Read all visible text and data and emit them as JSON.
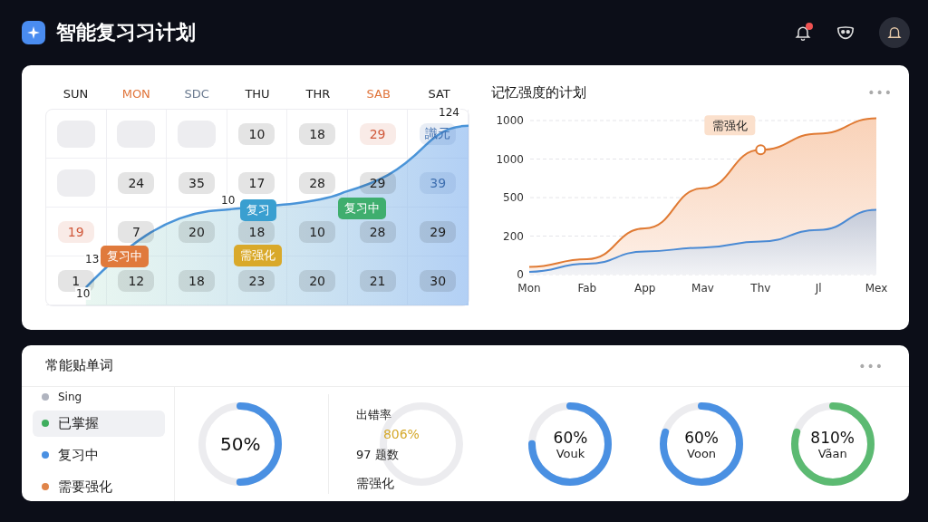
{
  "header": {
    "title": "智能复习习计划",
    "has_notification": true
  },
  "calendar": {
    "weekdays": [
      {
        "label": "SUN",
        "color": "#222222"
      },
      {
        "label": "MON",
        "color": "#e0743a"
      },
      {
        "label": "SDC",
        "color": "#6a7a90"
      },
      {
        "label": "THU",
        "color": "#222222"
      },
      {
        "label": "THR",
        "color": "#222222"
      },
      {
        "label": "SAB",
        "color": "#e0743a"
      },
      {
        "label": "SAT",
        "color": "#222222"
      }
    ],
    "rows": [
      [
        {
          "kind": "blank"
        },
        {
          "kind": "blank"
        },
        {
          "kind": "blank"
        },
        {
          "kind": "day",
          "text": "10",
          "color": "#222222"
        },
        {
          "kind": "day",
          "text": "18",
          "color": "#222222"
        },
        {
          "kind": "day",
          "text": "29",
          "color": "#d0583a"
        },
        {
          "kind": "day",
          "text": "識元",
          "color": "#3e6fb0"
        }
      ],
      [
        {
          "kind": "blank"
        },
        {
          "kind": "day",
          "text": "24",
          "color": "#222222"
        },
        {
          "kind": "day",
          "text": "35",
          "color": "#222222"
        },
        {
          "kind": "day",
          "text": "17",
          "color": "#222222"
        },
        {
          "kind": "day",
          "text": "28",
          "color": "#222222"
        },
        {
          "kind": "day",
          "text": "29",
          "color": "#222222"
        },
        {
          "kind": "day",
          "text": "39",
          "color": "#3e6fb0"
        }
      ],
      [
        {
          "kind": "day",
          "text": "19",
          "color": "#d0583a"
        },
        {
          "kind": "day",
          "text": "7",
          "color": "#222222"
        },
        {
          "kind": "day",
          "text": "20",
          "color": "#222222"
        },
        {
          "kind": "day",
          "text": "18",
          "color": "#222222"
        },
        {
          "kind": "day",
          "text": "10",
          "color": "#222222"
        },
        {
          "kind": "day",
          "text": "28",
          "color": "#222222"
        },
        {
          "kind": "day",
          "text": "29",
          "color": "#222222"
        }
      ],
      [
        {
          "kind": "day",
          "text": "1",
          "color": "#222222"
        },
        {
          "kind": "day",
          "text": "12",
          "color": "#222222"
        },
        {
          "kind": "day",
          "text": "18",
          "color": "#222222"
        },
        {
          "kind": "day",
          "text": "23",
          "color": "#222222"
        },
        {
          "kind": "day",
          "text": "20",
          "color": "#222222"
        },
        {
          "kind": "day",
          "text": "21",
          "color": "#222222"
        },
        {
          "kind": "day",
          "text": "30",
          "color": "#222222"
        }
      ]
    ],
    "curve_labels": [
      "10",
      "13",
      "10",
      "124"
    ],
    "tags": [
      {
        "text": "复习中",
        "color": "#e07a3c"
      },
      {
        "text": "复习",
        "color": "#3a9fd0"
      },
      {
        "text": "需强化",
        "color": "#d9a92a"
      },
      {
        "text": "复习中",
        "color": "#3fae6e"
      }
    ]
  },
  "chart_panel": {
    "title": "记忆强度的计划",
    "menu": "•••",
    "y_labels": [
      "1000",
      "1000",
      "500",
      "200",
      "0"
    ],
    "x_labels": [
      "Mon",
      "Fab",
      "App",
      "Mav",
      "Thv",
      "Jl",
      "Mex"
    ],
    "callout": "需强化"
  },
  "words_panel": {
    "title": "常能贴单词",
    "menu": "•••",
    "legend": [
      {
        "label": "Sing",
        "color": "#b0b4bf",
        "selected": false
      },
      {
        "label": "已掌握",
        "color": "#3fae5e",
        "selected": true
      },
      {
        "label": "复习中",
        "color": "#4a90e2",
        "selected": false
      },
      {
        "label": "需要强化",
        "color": "#e0854a",
        "selected": false
      }
    ],
    "stats": [
      {
        "kind": "ring",
        "value": "50%",
        "level": 0.5,
        "color": "#4a90e2"
      },
      {
        "kind": "detail",
        "label": "出错率",
        "value": "806%",
        "count": "97 题数",
        "note": "需强化"
      },
      {
        "kind": "ring",
        "value": "60%",
        "caption": "Vouk",
        "level": 0.75,
        "color": "#4a90e2"
      },
      {
        "kind": "ring",
        "value": "60%",
        "caption": "Voon",
        "level": 0.8,
        "color": "#4a90e2"
      },
      {
        "kind": "ring",
        "value": "810%",
        "caption": "Vãan",
        "level": 0.8,
        "color": "#5cba72"
      }
    ]
  }
}
